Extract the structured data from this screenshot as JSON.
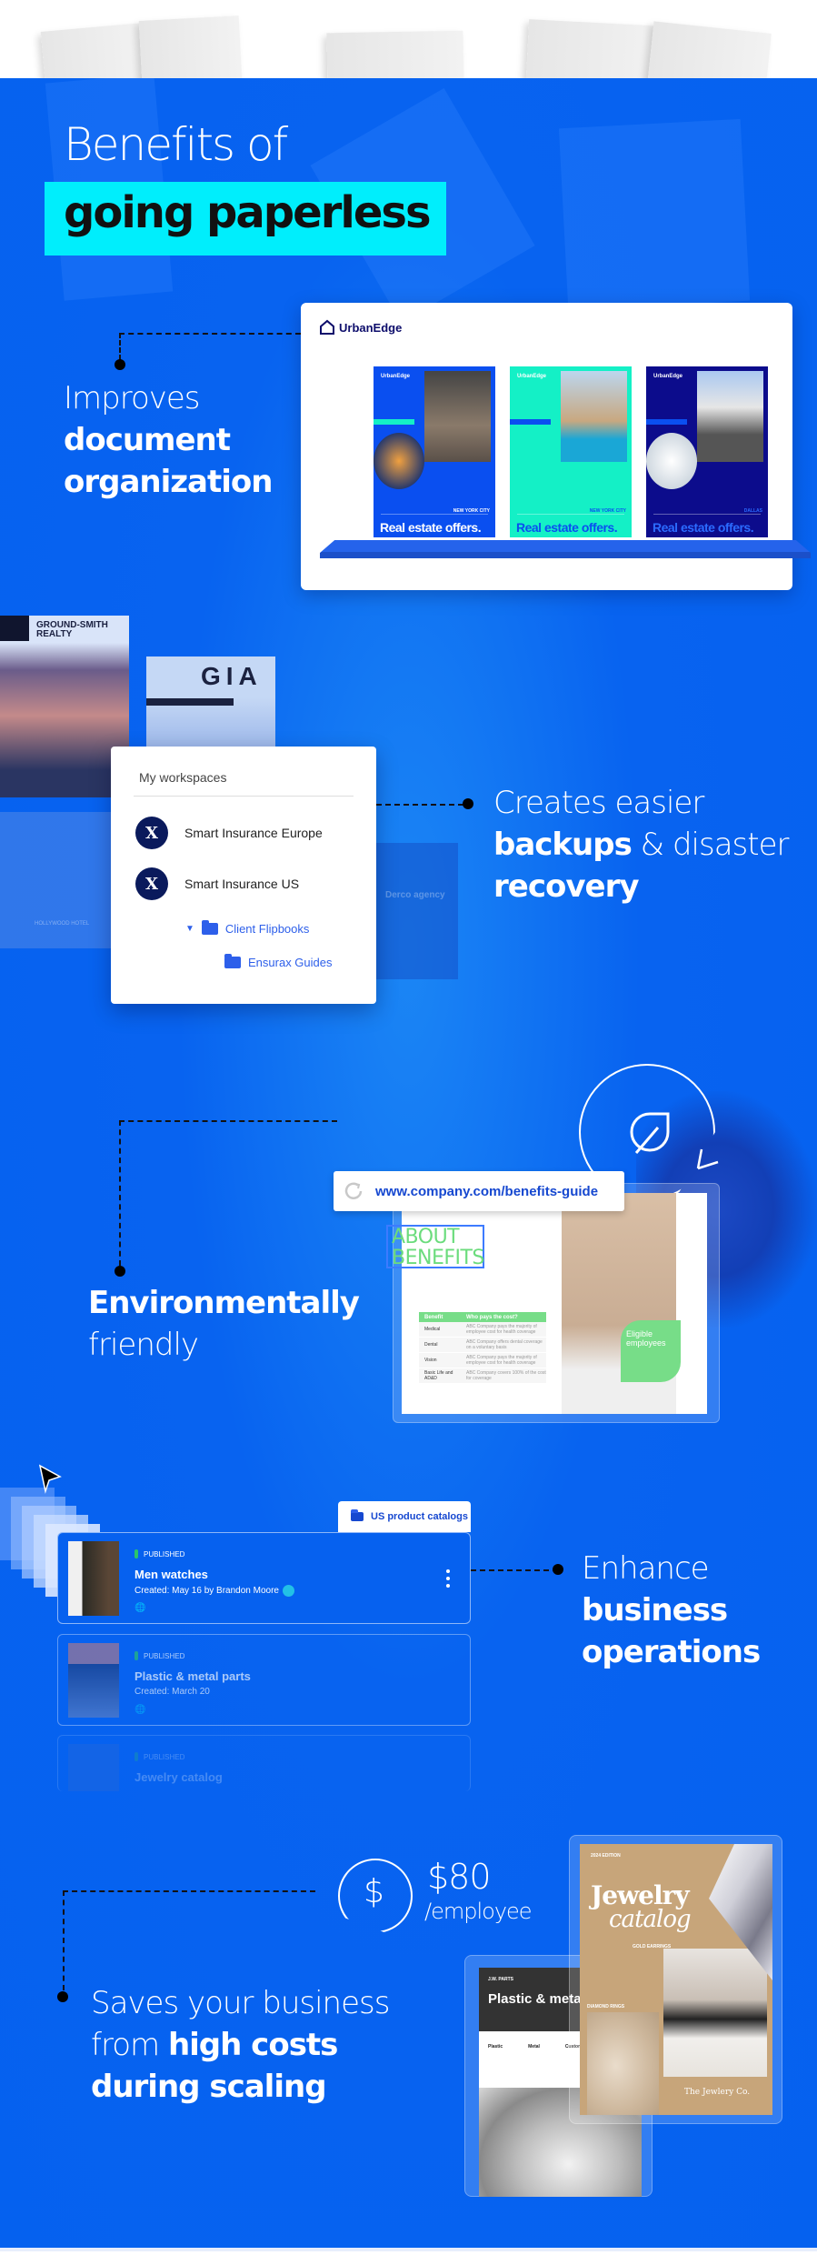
{
  "header": {
    "title_light": "Benefits of",
    "title_bold": "going paperless",
    "accent_color": "#00eefc",
    "background_color": "#0561ef"
  },
  "benefits": [
    {
      "light": "Improves",
      "bold": "document organization"
    },
    {
      "light_1": "Creates easier",
      "bold_1": "backups",
      "light_2": "& disaster",
      "bold_2": "recovery"
    },
    {
      "bold": "Environmentally",
      "light": "friendly"
    },
    {
      "light": "Enhance",
      "bold": "business operations"
    },
    {
      "light": "Saves your business from",
      "bold": "high costs during scaling"
    }
  ],
  "urbanedge": {
    "brand": "UrbanEdge",
    "posters": [
      {
        "title": "Real estate offers.",
        "city": "NEW YORK CITY",
        "bg": "#0a4ff0",
        "fg": "#ffffff"
      },
      {
        "title": "Real estate offers.",
        "city": "NEW YORK CITY",
        "bg": "#14f0c6",
        "fg": "#0a4ff0"
      },
      {
        "title": "Real estate offers.",
        "city": "DALLAS",
        "bg": "#0c0c8c",
        "fg": "#2b6bff"
      }
    ]
  },
  "thumbs": {
    "realty": "GROUND-SMITH REALTY",
    "gia": "GIA",
    "hotel": "HOLLYWOOD HOTEL",
    "agency": "Derco agency"
  },
  "workspaces": {
    "title": "My workspaces",
    "items": [
      {
        "name": "Smart Insurance Europe",
        "initial": "X"
      },
      {
        "name": "Smart Insurance US",
        "initial": "X"
      }
    ],
    "folders": [
      {
        "name": "Client Flipbooks",
        "expanded": true
      },
      {
        "name": "Ensurax Guides"
      }
    ]
  },
  "environment": {
    "url": "www.company.com/benefits-guide",
    "book_heading": "ABOUT BENEFITS",
    "table_headers": [
      "Benefit",
      "Who pays the cost?"
    ],
    "table_rows": [
      [
        "Medical",
        "ABC Company pays the majority of employee cost for health coverage"
      ],
      [
        "Dental",
        "ABC Company offers dental coverage on a voluntary basis"
      ],
      [
        "Vision",
        "ABC Company pays the majority of employee cost for health coverage"
      ],
      [
        "Basic Life and AD&D",
        "ABC Company covers 100% of the cost for coverage"
      ]
    ],
    "eligible_label": "Eligible employees"
  },
  "catalogs": {
    "folder": "US product catalogs",
    "items": [
      {
        "status": "PUBLISHED",
        "name": "Men watches",
        "meta": "Created: May 16 by Brandon Moore"
      },
      {
        "status": "PUBLISHED",
        "name": "Plastic & metal parts",
        "meta": "Created: March 20"
      },
      {
        "status": "PUBLISHED",
        "name": "Jewelry catalog",
        "meta": ""
      }
    ]
  },
  "cost": {
    "amount": "$80",
    "unit": "/employee",
    "icon_symbol": "$",
    "parts": {
      "brand": "J.W. PARTS",
      "title": "Plastic & metal parts",
      "columns": [
        "Plastic",
        "Metal",
        "Custom"
      ]
    },
    "jewelry": {
      "edition": "2024 EDITION",
      "title_1": "Jewelry",
      "title_2": "catalog",
      "label_1": "GOLD EARRINGS",
      "label_2": "DIAMOND RINGS",
      "brand": "The Jewlery Co."
    }
  }
}
